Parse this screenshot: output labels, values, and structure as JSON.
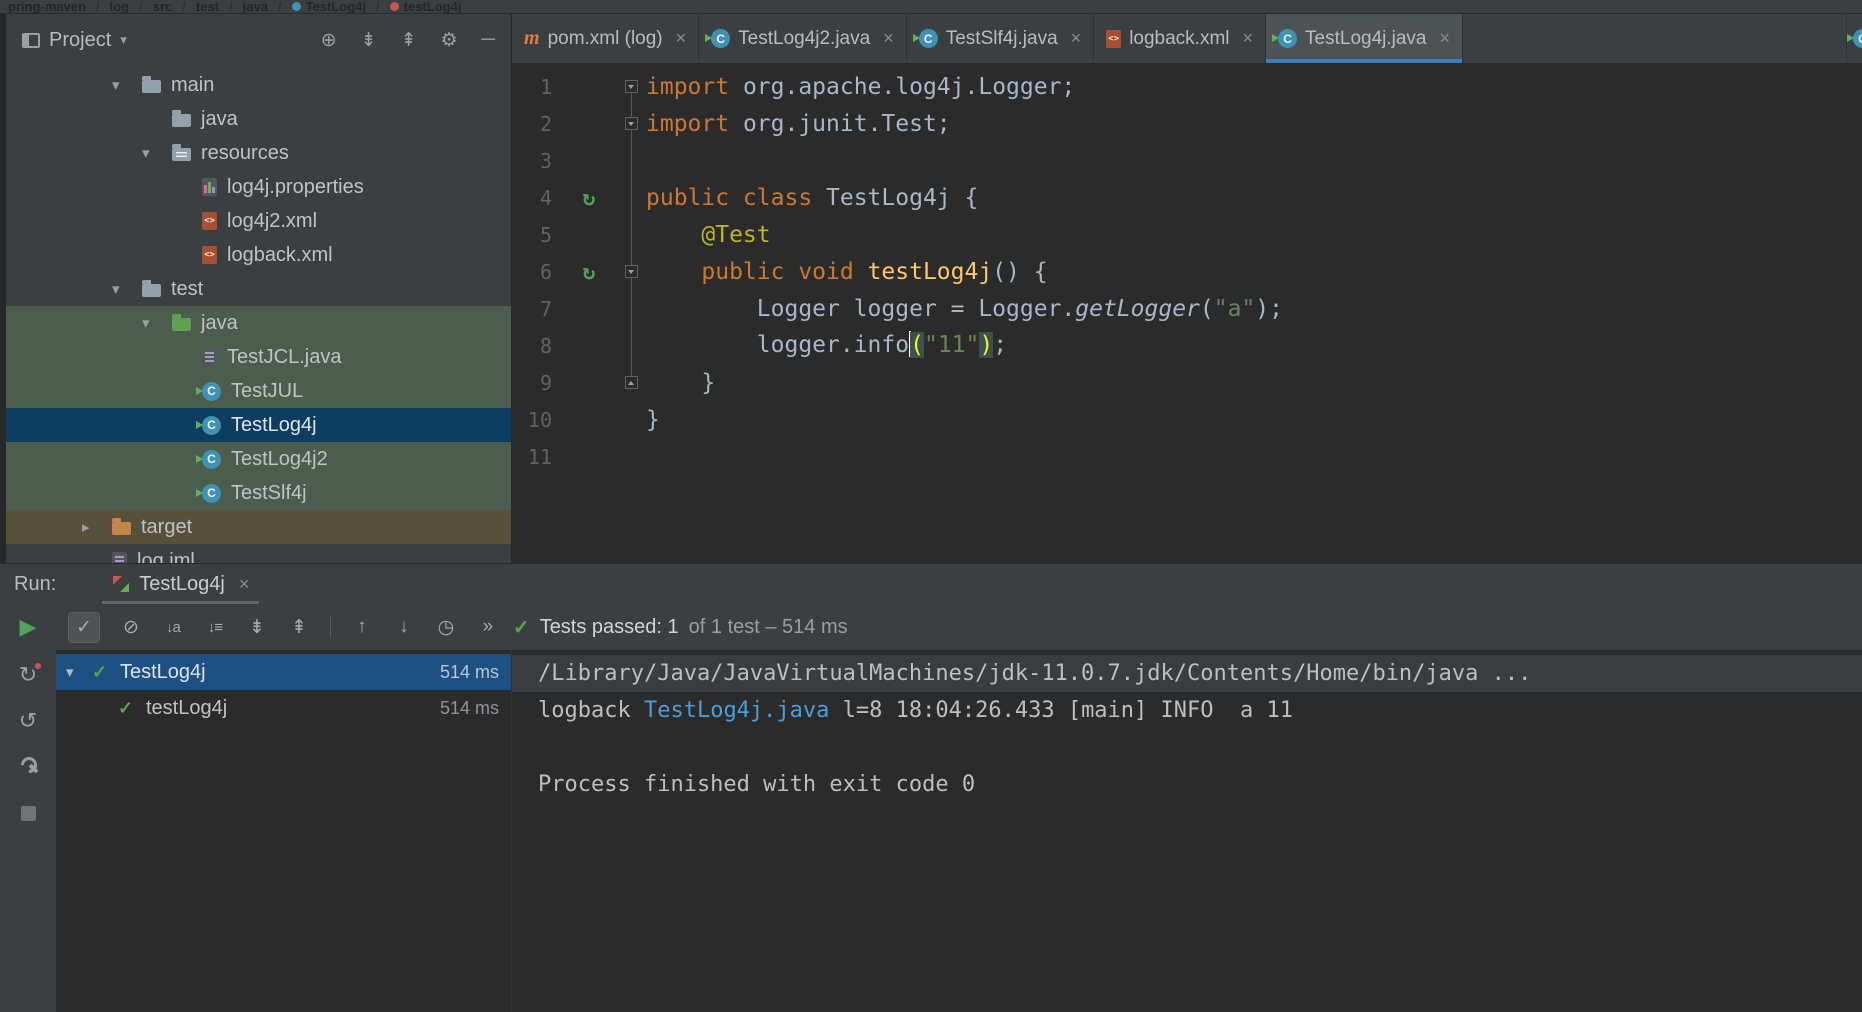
{
  "glyphs": {
    "dropdown": "▾",
    "chevron_down": "▾",
    "chevron_right": "▸",
    "close": "×",
    "check": "✓",
    "maven": "m",
    "gutter_run": "↻"
  },
  "nav": {
    "sep": "/",
    "items": [
      {
        "t": "pring-maven"
      },
      {
        "t": "log"
      },
      {
        "t": "src"
      },
      {
        "t": "test"
      },
      {
        "t": "java"
      },
      {
        "t": "TestLog4j",
        "icon": "class-dot"
      },
      {
        "t": "testLog4j",
        "icon": "method-dot"
      }
    ]
  },
  "project": {
    "title": "Project",
    "header_icons": [
      {
        "name": "locate-file-icon",
        "glyph": "⊕"
      },
      {
        "name": "expand-all-icon",
        "glyph": "⇟"
      },
      {
        "name": "collapse-all-icon",
        "glyph": "⇞"
      },
      {
        "name": "settings-gear-icon",
        "glyph": "⚙"
      },
      {
        "name": "hide-panel-icon",
        "glyph": "─"
      }
    ],
    "tree": [
      {
        "label": "main",
        "level": 2,
        "chevron": "down",
        "icon": "folder-icon"
      },
      {
        "label": "java",
        "level": 3,
        "chevron": null,
        "icon": "folder-icon"
      },
      {
        "label": "resources",
        "level": 3,
        "chevron": "down",
        "icon": "resources-folder-icon"
      },
      {
        "label": "log4j.properties",
        "level": 4,
        "chevron": null,
        "icon": "properties-file-icon"
      },
      {
        "label": "log4j2.xml",
        "level": 4,
        "chevron": null,
        "icon": "xml-file-icon"
      },
      {
        "label": "logback.xml",
        "level": 4,
        "chevron": null,
        "icon": "xml-file-icon"
      },
      {
        "label": "test",
        "level": 2,
        "chevron": "down",
        "icon": "folder-icon"
      },
      {
        "label": "java",
        "level": 3,
        "chevron": "down",
        "icon": "test-folder-icon",
        "bg": "green"
      },
      {
        "label": "TestJCL.java",
        "level": 4,
        "chevron": null,
        "icon": "java-file-icon",
        "bg": "green"
      },
      {
        "label": "TestJUL",
        "level": 4,
        "chevron": null,
        "icon": "test-class-icon",
        "bg": "green"
      },
      {
        "label": "TestLog4j",
        "level": 4,
        "chevron": null,
        "icon": "test-class-icon",
        "bg": "selected"
      },
      {
        "label": "TestLog4j2",
        "level": 4,
        "chevron": null,
        "icon": "test-class-icon",
        "bg": "green"
      },
      {
        "label": "TestSlf4j",
        "level": 4,
        "chevron": null,
        "icon": "test-class-icon",
        "bg": "green"
      },
      {
        "label": "target",
        "level": 1,
        "chevron": "right",
        "icon": "excluded-folder-icon",
        "bg": "target"
      },
      {
        "label": "log.iml",
        "level": 1,
        "chevron": null,
        "icon": "iml-file-icon"
      }
    ]
  },
  "editor": {
    "tabs": [
      {
        "label": "pom.xml (log)",
        "icon": "maven-icon"
      },
      {
        "label": "TestLog4j2.java",
        "icon": "test-class-icon"
      },
      {
        "label": "TestSlf4j.java",
        "icon": "test-class-icon"
      },
      {
        "label": "logback.xml",
        "icon": "xml-file-icon"
      },
      {
        "label": "TestLog4j.java",
        "icon": "test-class-icon",
        "active": true
      },
      {
        "label": "",
        "icon": "test-class-icon",
        "partial": true
      }
    ],
    "code": {
      "lines": [
        {
          "num": "1",
          "fold": "open",
          "tokens": [
            {
              "t": "import",
              "c": "kw"
            },
            {
              "t": " org.apache.log4j.Logger;",
              "c": "pl"
            }
          ]
        },
        {
          "num": "2",
          "fold": "open",
          "tokens": [
            {
              "t": "import",
              "c": "kw"
            },
            {
              "t": " org.junit.Test;",
              "c": "pl"
            }
          ]
        },
        {
          "num": "3",
          "tokens": []
        },
        {
          "num": "4",
          "gutter": "run",
          "tokens": [
            {
              "t": "public class ",
              "c": "kw"
            },
            {
              "t": "TestLog4j {",
              "c": "pl"
            }
          ]
        },
        {
          "num": "5",
          "tokens": [
            {
              "t": "    ",
              "c": "pl"
            },
            {
              "t": "@Test",
              "c": "ann"
            }
          ]
        },
        {
          "num": "6",
          "gutter": "run",
          "fold": "open",
          "tokens": [
            {
              "t": "    ",
              "c": "pl"
            },
            {
              "t": "public void ",
              "c": "kw"
            },
            {
              "t": "testLog4j",
              "c": "mth"
            },
            {
              "t": "() {",
              "c": "pl"
            }
          ]
        },
        {
          "num": "7",
          "tokens": [
            {
              "t": "        Logger logger = Logger.",
              "c": "pl"
            },
            {
              "t": "getLogger",
              "c": "stm"
            },
            {
              "t": "(",
              "c": "pl"
            },
            {
              "t": "\"a\"",
              "c": "str"
            },
            {
              "t": ");",
              "c": "pl"
            }
          ]
        },
        {
          "num": "8",
          "tokens": [
            {
              "t": "        logger.info",
              "c": "pl"
            },
            {
              "t": "",
              "c": "caret"
            },
            {
              "t": "(",
              "c": "brace"
            },
            {
              "t": "\"11\"",
              "c": "str"
            },
            {
              "t": ")",
              "c": "brace"
            },
            {
              "t": ";",
              "c": "pl"
            }
          ]
        },
        {
          "num": "9",
          "fold": "end",
          "tokens": [
            {
              "t": "    }",
              "c": "pl"
            }
          ]
        },
        {
          "num": "10",
          "tokens": [
            {
              "t": "}",
              "c": "pl"
            }
          ]
        },
        {
          "num": "11",
          "tokens": []
        }
      ]
    }
  },
  "run": {
    "label": "Run:",
    "tab": {
      "label": "TestLog4j"
    },
    "toolbar": [
      {
        "name": "show-passed-button",
        "glyph": "✓",
        "toggled": true
      },
      {
        "name": "show-ignored-button",
        "glyph": "⊘"
      },
      {
        "name": "sort-alphabetically-button",
        "glyph": "↓a",
        "cls": "sort"
      },
      {
        "name": "sort-by-duration-button",
        "glyph": "↓≡",
        "cls": "sort"
      },
      {
        "name": "expand-all-button",
        "glyph": "⇟"
      },
      {
        "name": "collapse-all-button",
        "glyph": "⇞"
      },
      {
        "sep": true
      },
      {
        "name": "previous-failed-test-button",
        "glyph": "↑"
      },
      {
        "name": "next-failed-test-button",
        "glyph": "↓"
      },
      {
        "name": "test-history-button",
        "glyph": "◷"
      },
      {
        "name": "more-options-button",
        "glyph": "»"
      }
    ],
    "status": {
      "main": "Tests passed: 1",
      "secondary": "of 1 test – 514 ms"
    },
    "strip": [
      {
        "name": "rerun-button",
        "glyph": "▶",
        "cls": "strip-play"
      },
      {
        "name": "rerun-failed-tests-button",
        "glyph": "↻",
        "cls": "strip-icon dotted"
      },
      {
        "name": "refresh-button",
        "glyph": "↺",
        "cls": "strip-icon"
      },
      {
        "name": "settings-wrench-button",
        "cls": "wrench"
      },
      {
        "name": "stop-button",
        "cls": "stop-square"
      }
    ],
    "tree": [
      {
        "label": "TestLog4j",
        "time": "514 ms",
        "chevron": true,
        "selected": true
      },
      {
        "label": "testLog4j",
        "time": "514 ms",
        "child": true
      }
    ],
    "console": [
      {
        "hl": true,
        "segments": [
          {
            "t": "/Library/Java/JavaVirtualMachines/jdk-11.0.7.jdk/Contents/Home/bin/java ...",
            "c": "pl"
          }
        ]
      },
      {
        "segments": [
          {
            "t": "logback ",
            "c": "pl"
          },
          {
            "t": "TestLog4j.java",
            "c": "link"
          },
          {
            "t": " l=8 18:04:26.433 [main] INFO  a 11",
            "c": "pl"
          }
        ]
      },
      {
        "segments": []
      },
      {
        "segments": [
          {
            "t": "Process finished with exit code 0",
            "c": "pl"
          }
        ]
      }
    ]
  }
}
